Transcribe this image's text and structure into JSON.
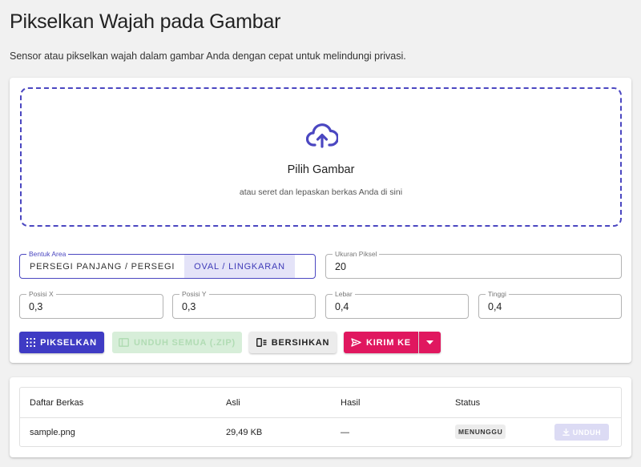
{
  "page": {
    "title": "Pikselkan Wajah pada Gambar",
    "description": "Sensor atau pikselkan wajah dalam gambar Anda dengan cepat untuk melindungi privasi."
  },
  "dropzone": {
    "title": "Pilih Gambar",
    "subtitle": "atau seret dan lepaskan berkas Anda di sini",
    "icon": "cloud-upload-icon"
  },
  "settings": {
    "shape": {
      "label": "Bentuk Area",
      "options": [
        "PERSEGI PANJANG / PERSEGI",
        "OVAL / LINGKARAN"
      ],
      "selected": "OVAL / LINGKARAN"
    },
    "pixel_size": {
      "label": "Ukuran Piksel",
      "value": "20"
    },
    "pos_x": {
      "label": "Posisi X",
      "value": "0,3"
    },
    "pos_y": {
      "label": "Posisi Y",
      "value": "0,3"
    },
    "width": {
      "label": "Lebar",
      "value": "0,4"
    },
    "height": {
      "label": "Tinggi",
      "value": "0,4"
    }
  },
  "actions": {
    "pixelate": "PIKSELKAN",
    "download_all": "UNDUH SEMUA (.ZIP)",
    "clear": "BERSIHKAN",
    "send_to": "KIRIM KE"
  },
  "files": {
    "headers": [
      "Daftar Berkas",
      "Asli",
      "Hasil",
      "Status"
    ],
    "rows": [
      {
        "name": "sample.png",
        "original": "29,49 KB",
        "result": "—",
        "status": "MENUNGGU",
        "download": "UNDUH"
      }
    ]
  },
  "colors": {
    "primary": "#3f3bc4",
    "accent": "#e0175f",
    "success_disabled": "#d7eed9"
  }
}
